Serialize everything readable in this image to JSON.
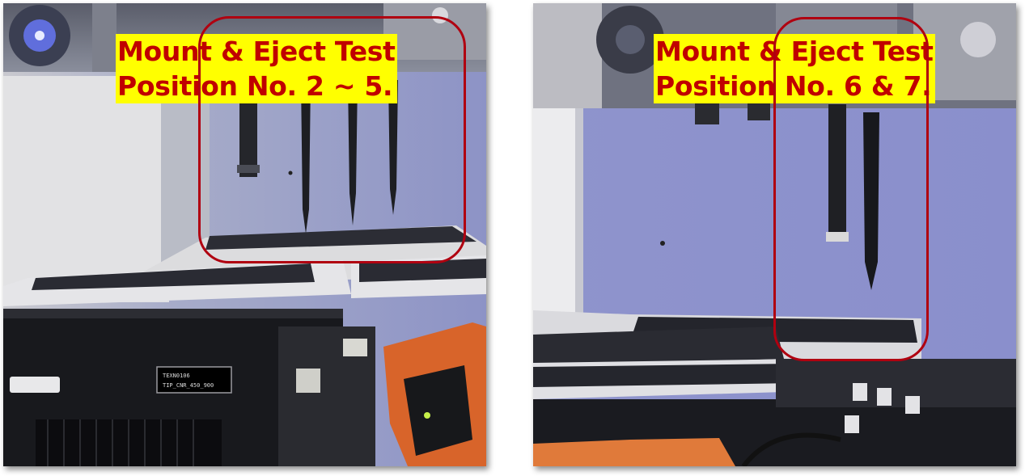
{
  "panels": [
    {
      "id": "left",
      "caption_line1": "Mount & Eject Test",
      "caption_line2": "Position No. 2 ~ 5.",
      "box_color": "#b00010",
      "label_tag_line1": "TEXN0106",
      "label_tag_line2": "TIP_CNR_450_900"
    },
    {
      "id": "right",
      "caption_line1": "Mount & Eject Test",
      "caption_line2": "Position No. 6 & 7.",
      "box_color": "#b00010"
    }
  ],
  "colors": {
    "caption_text": "#c00000",
    "caption_bg": "#ffff00",
    "wall": "#9aa2c8"
  }
}
